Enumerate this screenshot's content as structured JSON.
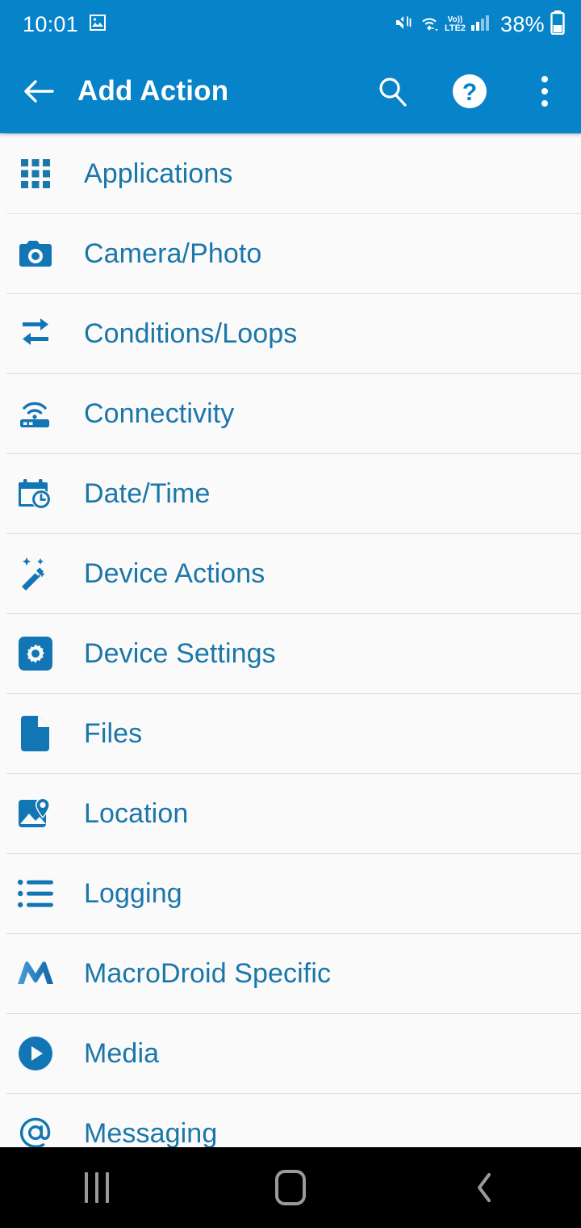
{
  "status_bar": {
    "time": "10:01",
    "battery_text": "38%",
    "icons": [
      "image-icon",
      "mute-vibrate-icon",
      "wifi-icon",
      "volte-icon",
      "signal-icon",
      "battery-icon"
    ],
    "volte_top": "Vo))",
    "volte_bottom": "LTE2",
    "background_color": "#0683c9"
  },
  "app_bar": {
    "title": "Add Action",
    "back_label": "Back",
    "search_label": "Search",
    "help_label": "Help",
    "overflow_label": "More options",
    "background_color": "#0683c9",
    "title_color": "#ffffff"
  },
  "list": {
    "accent_color": "#1b76a9",
    "background_color": "#fafafa",
    "divider_color": "#d9e2ea",
    "items": [
      {
        "label": "Applications",
        "icon": "apps-grid-icon"
      },
      {
        "label": "Camera/Photo",
        "icon": "camera-icon"
      },
      {
        "label": "Conditions/Loops",
        "icon": "loop-arrows-icon"
      },
      {
        "label": "Connectivity",
        "icon": "router-wifi-icon"
      },
      {
        "label": "Date/Time",
        "icon": "calendar-clock-icon"
      },
      {
        "label": "Device Actions",
        "icon": "magic-wand-icon"
      },
      {
        "label": "Device Settings",
        "icon": "gear-icon"
      },
      {
        "label": "Files",
        "icon": "file-document-icon"
      },
      {
        "label": "Location",
        "icon": "map-pin-icon"
      },
      {
        "label": "Logging",
        "icon": "bullet-list-icon"
      },
      {
        "label": "MacroDroid Specific",
        "icon": "macrodroid-logo-icon"
      },
      {
        "label": "Media",
        "icon": "play-circle-icon"
      },
      {
        "label": "Messaging",
        "icon": "at-sign-icon"
      }
    ]
  },
  "nav_bar": {
    "recents_label": "Recents",
    "home_label": "Home",
    "back_label": "Back",
    "background_color": "#000000"
  }
}
